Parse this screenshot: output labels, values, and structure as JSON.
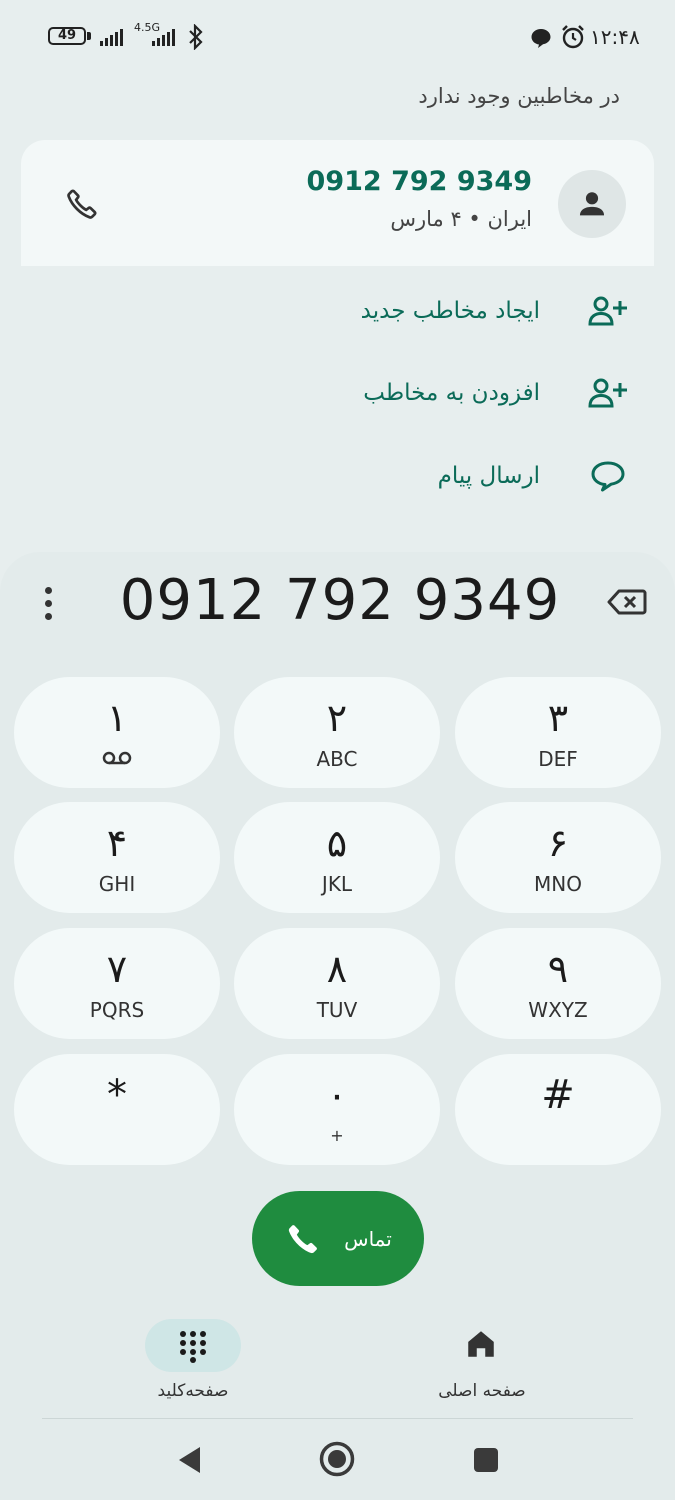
{
  "status_bar": {
    "battery": "49",
    "network": "4.5G",
    "time": "۱۲:۴۸",
    "icons": [
      "battery-icon",
      "signal-icon",
      "signal-icon",
      "bluetooth-icon",
      "message-icon",
      "alarm-icon"
    ]
  },
  "header": {
    "no_contacts": "در مخاطبین وجود ندارد"
  },
  "contact_card": {
    "number": "0912 792 9349",
    "subtitle": "ایران • ۴ مارس"
  },
  "actions": [
    {
      "label": "ایجاد مخاطب جدید",
      "icon": "person-add-icon"
    },
    {
      "label": "افزودن به مخاطب",
      "icon": "person-add-icon"
    },
    {
      "label": "ارسال پیام",
      "icon": "message-icon"
    }
  ],
  "dialer": {
    "entered_number": "0912 792 9349",
    "keys": [
      {
        "digit": "۱",
        "sub": "",
        "sub_icon": "voicemail-icon"
      },
      {
        "digit": "۲",
        "sub": "ABC"
      },
      {
        "digit": "۳",
        "sub": "DEF"
      },
      {
        "digit": "۴",
        "sub": "GHI"
      },
      {
        "digit": "۵",
        "sub": "JKL"
      },
      {
        "digit": "۶",
        "sub": "MNO"
      },
      {
        "digit": "۷",
        "sub": "PQRS"
      },
      {
        "digit": "۸",
        "sub": "TUV"
      },
      {
        "digit": "۹",
        "sub": "WXYZ"
      },
      {
        "digit": "*",
        "sub": ""
      },
      {
        "digit": "۰",
        "sub": "+"
      },
      {
        "digit": "#",
        "sub": ""
      }
    ],
    "call_label": "تماس"
  },
  "bottom_nav": {
    "keypad_label": "صفحه‌کلید",
    "home_label": "صفحه اصلی"
  },
  "colors": {
    "accent": "#0b6b58",
    "call": "#1f8c3f",
    "background": "#e7eeee"
  }
}
